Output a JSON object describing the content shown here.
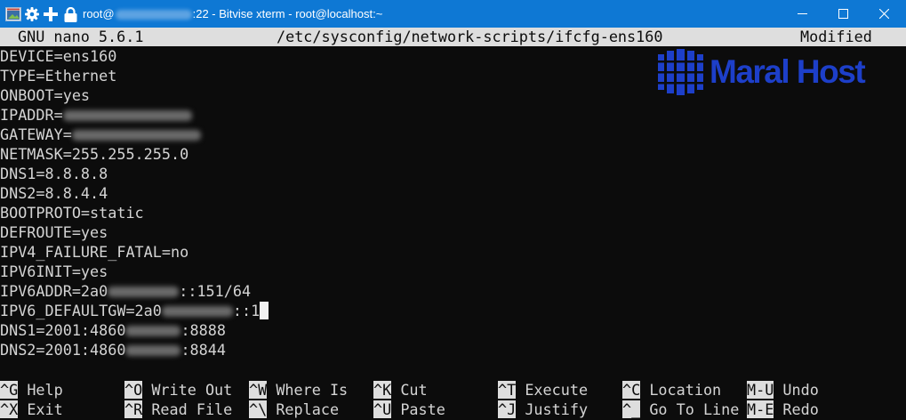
{
  "window": {
    "title_prefix": "root@",
    "title_suffix": ":22 - Bitvise xterm - root@localhost:~",
    "accent": "#0e78d4"
  },
  "nano": {
    "version": "GNU nano 5.6.1",
    "file": "/etc/sysconfig/network-scripts/ifcfg-ens160",
    "status": "Modified"
  },
  "brand": {
    "name": "Maral Host",
    "color": "#1d3fc9"
  },
  "lines": [
    {
      "text": "DEVICE=ens160"
    },
    {
      "text": "TYPE=Ethernet"
    },
    {
      "text": "ONBOOT=yes"
    },
    {
      "text": "IPADDR="
    },
    {
      "text": "GATEWAY="
    },
    {
      "text": "NETMASK=255.255.255.0"
    },
    {
      "text": "DNS1=8.8.8.8"
    },
    {
      "text": "DNS2=8.8.4.4"
    },
    {
      "text": "BOOTPROTO=static"
    },
    {
      "text": "DEFROUTE=yes"
    },
    {
      "text": "IPV4_FAILURE_FATAL=no"
    },
    {
      "text": "IPV6INIT=yes"
    },
    {
      "text": "IPV6ADDR=2a0",
      "after": "::151/64"
    },
    {
      "text": "IPV6_DEFAULTGW=2a0",
      "after": "::1"
    },
    {
      "text": "DNS1=2001:4860",
      "after": ":8888"
    },
    {
      "text": "DNS2=2001:4860",
      "after": ":8844"
    }
  ],
  "shortcuts": [
    {
      "key": "^G",
      "label": "Help"
    },
    {
      "key": "^O",
      "label": "Write Out"
    },
    {
      "key": "^W",
      "label": "Where Is"
    },
    {
      "key": "^K",
      "label": "Cut"
    },
    {
      "key": "^T",
      "label": "Execute"
    },
    {
      "key": "^C",
      "label": "Location"
    },
    {
      "key": "M-U",
      "label": "Undo"
    },
    {
      "key": "^X",
      "label": "Exit"
    },
    {
      "key": "^R",
      "label": "Read File"
    },
    {
      "key": "^\\",
      "label": "Replace"
    },
    {
      "key": "^U",
      "label": "Paste"
    },
    {
      "key": "^J",
      "label": "Justify"
    },
    {
      "key": "^_",
      "label": "Go To Line"
    },
    {
      "key": "M-E",
      "label": "Redo"
    }
  ]
}
